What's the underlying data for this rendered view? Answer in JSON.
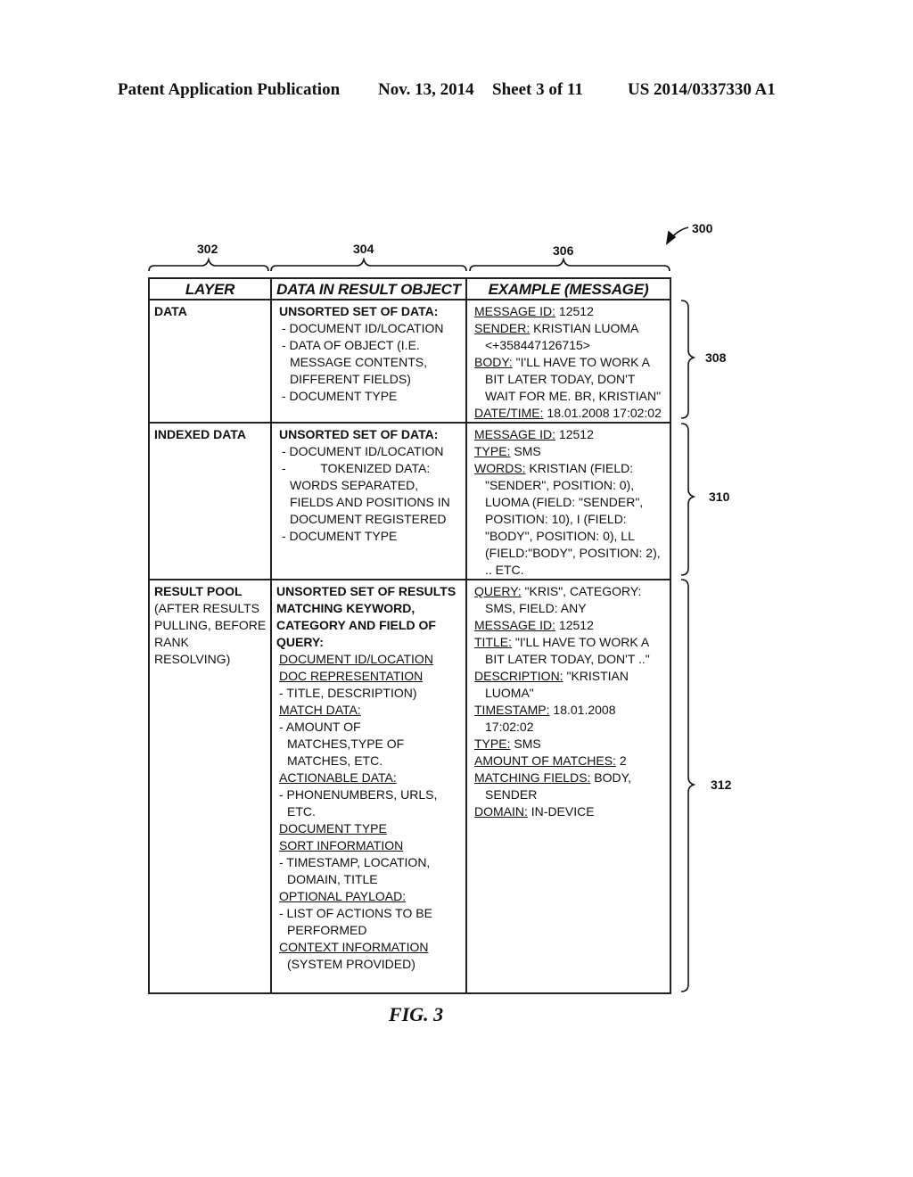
{
  "header": {
    "publication": "Patent Application Publication",
    "date": "Nov. 13, 2014",
    "sheet": "Sheet 3 of 11",
    "number": "US 2014/0337330 A1"
  },
  "refs": {
    "figure": "300",
    "col_layer": "302",
    "col_data": "304",
    "col_example": "306",
    "row_data": "308",
    "row_indexed": "310",
    "row_result": "312"
  },
  "table": {
    "headers": [
      "LAYER",
      "DATA IN RESULT OBJECT",
      "EXAMPLE (MESSAGE)"
    ],
    "rows": [
      {
        "layer": [
          "DATA"
        ],
        "data": [
          {
            "text": "UNSORTED SET OF DATA:",
            "style": "bold"
          },
          {
            "text": "- DOCUMENT ID/LOCATION",
            "style": "item"
          },
          {
            "text": "- DATA OF OBJECT (I.E.",
            "style": "item"
          },
          {
            "text": "MESSAGE CONTENTS,",
            "style": "cont"
          },
          {
            "text": "DIFFERENT FIELDS)",
            "style": "cont"
          },
          {
            "text": "- DOCUMENT TYPE",
            "style": "item"
          }
        ],
        "example": [
          {
            "label": "MESSAGE ID:",
            "value": " 12512"
          },
          {
            "label": "SENDER:",
            "value": " KRISTIAN LUOMA"
          },
          {
            "label": "",
            "value": "<+358447126715>",
            "cont": true
          },
          {
            "label": "BODY:",
            "value": " \"I'LL HAVE TO WORK A"
          },
          {
            "label": "",
            "value": "BIT LATER TODAY, DON'T",
            "cont": true
          },
          {
            "label": "",
            "value": "WAIT FOR ME. BR, KRISTIAN\"",
            "cont": true
          },
          {
            "label": "DATE/TIME:",
            "value": " 18.01.2008 17:02:02"
          }
        ]
      },
      {
        "layer": [
          "INDEXED DATA"
        ],
        "data": [
          {
            "text": "UNSORTED SET OF DATA:",
            "style": "bold"
          },
          {
            "text": "- DOCUMENT ID/LOCATION",
            "style": "item"
          },
          {
            "text": "-          TOKENIZED DATA:",
            "style": "item"
          },
          {
            "text": "WORDS SEPARATED,",
            "style": "cont"
          },
          {
            "text": "FIELDS AND POSITIONS IN",
            "style": "cont"
          },
          {
            "text": "DOCUMENT REGISTERED",
            "style": "cont"
          },
          {
            "text": "- DOCUMENT TYPE",
            "style": "item"
          }
        ],
        "example": [
          {
            "label": "MESSAGE ID:",
            "value": " 12512"
          },
          {
            "label": "TYPE:",
            "value": " SMS"
          },
          {
            "label": "WORDS:",
            "value": " KRISTIAN (FIELD:"
          },
          {
            "label": "",
            "value": "\"SENDER\", POSITION: 0),",
            "cont": true
          },
          {
            "label": "",
            "value": "LUOMA (FIELD: \"SENDER\",",
            "cont": true
          },
          {
            "label": "",
            "value": "POSITION: 10), I (FIELD:",
            "cont": true
          },
          {
            "label": "",
            "value": "\"BODY\", POSITION: 0), LL",
            "cont": true
          },
          {
            "label": "",
            "value": "(FIELD:\"BODY\", POSITION: 2),",
            "cont": true
          },
          {
            "label": "",
            "value": ".. ETC.",
            "cont": true
          }
        ]
      },
      {
        "layer": [
          "RESULT POOL",
          "(AFTER RESULTS",
          "PULLING, BEFORE",
          "RANK",
          "RESOLVING)"
        ],
        "data": [
          {
            "text": "UNSORTED SET OF RESULTS",
            "style": "bold"
          },
          {
            "text": "MATCHING KEYWORD,",
            "style": "bold"
          },
          {
            "text": "CATEGORY AND FIELD OF",
            "style": "bold"
          },
          {
            "text": "QUERY:",
            "style": "bold"
          },
          {
            "text": "DOCUMENT ID/LOCATION",
            "style": "underline"
          },
          {
            "text": "DOC REPRESENTATION",
            "style": "underline"
          },
          {
            "text": "- TITLE, DESCRIPTION)",
            "style": "item"
          },
          {
            "text": "MATCH DATA:",
            "style": "underline"
          },
          {
            "text": "- AMOUNT OF",
            "style": "item"
          },
          {
            "text": "MATCHES,TYPE OF",
            "style": "cont"
          },
          {
            "text": "MATCHES, ETC.",
            "style": "cont"
          },
          {
            "text": "ACTIONABLE DATA:",
            "style": "underline"
          },
          {
            "text": "- PHONENUMBERS, URLS,",
            "style": "item"
          },
          {
            "text": "ETC.",
            "style": "cont"
          },
          {
            "text": "DOCUMENT TYPE",
            "style": "underline"
          },
          {
            "text": "SORT INFORMATION",
            "style": "underline"
          },
          {
            "text": "- TIMESTAMP, LOCATION,",
            "style": "item"
          },
          {
            "text": "DOMAIN, TITLE",
            "style": "cont"
          },
          {
            "text": "OPTIONAL PAYLOAD:",
            "style": "underline"
          },
          {
            "text": "- LIST OF ACTIONS TO BE",
            "style": "item"
          },
          {
            "text": "PERFORMED",
            "style": "cont"
          },
          {
            "text": "CONTEXT INFORMATION",
            "style": "underline"
          },
          {
            "text": "(SYSTEM PROVIDED)",
            "style": "cont"
          }
        ],
        "example": [
          {
            "label": "QUERY:",
            "value": " \"KRIS\", CATEGORY:"
          },
          {
            "label": "",
            "value": "SMS, FIELD: ANY",
            "cont": true
          },
          {
            "label": "MESSAGE ID:",
            "value": " 12512"
          },
          {
            "label": "TITLE:",
            "value": " \"I'LL HAVE TO WORK A"
          },
          {
            "label": "",
            "value": "BIT LATER TODAY, DON'T ..\"",
            "cont": true
          },
          {
            "label": "DESCRIPTION:",
            "value": " \"KRISTIAN"
          },
          {
            "label": "",
            "value": "LUOMA\"",
            "cont": true
          },
          {
            "label": "TIMESTAMP:",
            "value": " 18.01.2008"
          },
          {
            "label": "",
            "value": "17:02:02",
            "cont": true
          },
          {
            "label": "TYPE:",
            "value": " SMS"
          },
          {
            "label": "AMOUNT OF MATCHES:",
            "value": " 2"
          },
          {
            "label": "MATCHING FIELDS:",
            "value": " BODY,"
          },
          {
            "label": "",
            "value": "SENDER",
            "cont": true
          },
          {
            "label": "DOMAIN:",
            "value": " IN-DEVICE"
          }
        ]
      }
    ]
  },
  "caption": "FIG. 3"
}
